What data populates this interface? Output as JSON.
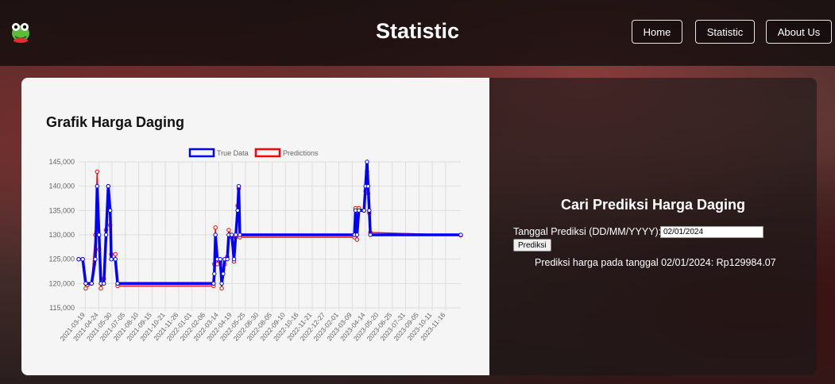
{
  "header": {
    "title": "Statistic"
  },
  "nav": {
    "home": "Home",
    "statistic": "Statistic",
    "about": "About Us"
  },
  "left": {
    "chart_heading": "Grafik Harga Daging"
  },
  "right": {
    "title": "Cari Prediksi Harga Daging",
    "date_label": "Tanggal Prediksi (DD/MM/YYYY):",
    "date_value": "02/01/2024",
    "button_label": "Prediksi",
    "result": "Prediksi harga pada tanggal 02/01/2024: Rp129984.07"
  },
  "colors": {
    "true_data": "#0000ff",
    "predictions": "#ff0000",
    "accent": "#ffffff"
  },
  "chart_data": {
    "type": "line",
    "legend_position": "top",
    "grid": true,
    "ylim": [
      115000,
      145000
    ],
    "yticks": [
      "145,000",
      "140,000",
      "135,000",
      "130,000",
      "125,000",
      "120,000",
      "115,000"
    ],
    "xticks": [
      "2021-03-19",
      "2021-04-24",
      "2021-05-30",
      "2021-07-05",
      "2021-08-10",
      "2021-09-15",
      "2021-10-21",
      "2021-11-26",
      "2022-01-01",
      "2022-02-06",
      "2022-03-14",
      "2022-04-19",
      "2022-05-25",
      "2022-06-30",
      "2022-08-05",
      "2022-09-10",
      "2022-10-16",
      "2022-11-21",
      "2022-12-27",
      "2023-02-01",
      "2023-03-09",
      "2023-04-14",
      "2023-05-20",
      "2023-06-25",
      "2023-07-31",
      "2023-09-05",
      "2023-10-11",
      "2023-11-16"
    ],
    "xdomain": [
      "2021-03-01",
      "2023-12-27"
    ],
    "series": [
      {
        "name": "True Data",
        "points": [
          [
            "2021-03-01",
            125000
          ],
          [
            "2021-03-12",
            125000
          ],
          [
            "2021-03-20",
            120000
          ],
          [
            "2021-04-05",
            120000
          ],
          [
            "2021-04-15",
            125000
          ],
          [
            "2021-04-20",
            140000
          ],
          [
            "2021-04-25",
            130000
          ],
          [
            "2021-04-30",
            120000
          ],
          [
            "2021-05-08",
            120000
          ],
          [
            "2021-05-14",
            130000
          ],
          [
            "2021-05-20",
            140000
          ],
          [
            "2021-05-25",
            135000
          ],
          [
            "2021-05-28",
            125000
          ],
          [
            "2021-06-08",
            125000
          ],
          [
            "2021-06-14",
            120000
          ],
          [
            "2022-02-28",
            120000
          ],
          [
            "2022-03-02",
            122000
          ],
          [
            "2022-03-05",
            130000
          ],
          [
            "2022-03-10",
            125000
          ],
          [
            "2022-03-18",
            125000
          ],
          [
            "2022-03-22",
            120000
          ],
          [
            "2022-03-26",
            122000
          ],
          [
            "2022-03-30",
            125000
          ],
          [
            "2022-04-06",
            125000
          ],
          [
            "2022-04-10",
            130000
          ],
          [
            "2022-04-18",
            130000
          ],
          [
            "2022-04-24",
            125000
          ],
          [
            "2022-04-29",
            130000
          ],
          [
            "2022-05-04",
            135000
          ],
          [
            "2022-05-07",
            140000
          ],
          [
            "2022-05-10",
            130000
          ],
          [
            "2023-03-15",
            130000
          ],
          [
            "2023-03-18",
            135000
          ],
          [
            "2023-03-22",
            130000
          ],
          [
            "2023-03-27",
            135000
          ],
          [
            "2023-04-10",
            135000
          ],
          [
            "2023-04-14",
            140000
          ],
          [
            "2023-04-18",
            145000
          ],
          [
            "2023-04-21",
            140000
          ],
          [
            "2023-04-24",
            135000
          ],
          [
            "2023-04-27",
            130000
          ],
          [
            "2023-12-27",
            130000
          ]
        ]
      },
      {
        "name": "Predictions",
        "points": [
          [
            "2021-03-01",
            125000
          ],
          [
            "2021-03-12",
            125000
          ],
          [
            "2021-03-20",
            119000
          ],
          [
            "2021-04-05",
            120000
          ],
          [
            "2021-04-15",
            130000
          ],
          [
            "2021-04-20",
            143000
          ],
          [
            "2021-04-25",
            127000
          ],
          [
            "2021-04-30",
            119000
          ],
          [
            "2021-05-08",
            121000
          ],
          [
            "2021-05-14",
            131000
          ],
          [
            "2021-05-20",
            140000
          ],
          [
            "2021-05-25",
            132000
          ],
          [
            "2021-05-28",
            126000
          ],
          [
            "2021-06-08",
            126000
          ],
          [
            "2021-06-14",
            119500
          ],
          [
            "2022-02-28",
            119500
          ],
          [
            "2022-03-02",
            124000
          ],
          [
            "2022-03-05",
            131500
          ],
          [
            "2022-03-10",
            124000
          ],
          [
            "2022-03-18",
            124500
          ],
          [
            "2022-03-22",
            119000
          ],
          [
            "2022-03-26",
            123000
          ],
          [
            "2022-03-30",
            124000
          ],
          [
            "2022-04-06",
            125500
          ],
          [
            "2022-04-10",
            131000
          ],
          [
            "2022-04-18",
            129500
          ],
          [
            "2022-04-24",
            124500
          ],
          [
            "2022-04-29",
            129500
          ],
          [
            "2022-05-04",
            136000
          ],
          [
            "2022-05-07",
            139500
          ],
          [
            "2022-05-10",
            129500
          ],
          [
            "2023-03-15",
            129500
          ],
          [
            "2023-03-18",
            135500
          ],
          [
            "2023-03-22",
            129000
          ],
          [
            "2023-03-27",
            135500
          ],
          [
            "2023-04-10",
            135000
          ],
          [
            "2023-04-14",
            139000
          ],
          [
            "2023-04-18",
            143000
          ],
          [
            "2023-04-21",
            138500
          ],
          [
            "2023-04-24",
            134500
          ],
          [
            "2023-04-27",
            130500
          ],
          [
            "2023-12-27",
            129900
          ]
        ]
      }
    ]
  }
}
